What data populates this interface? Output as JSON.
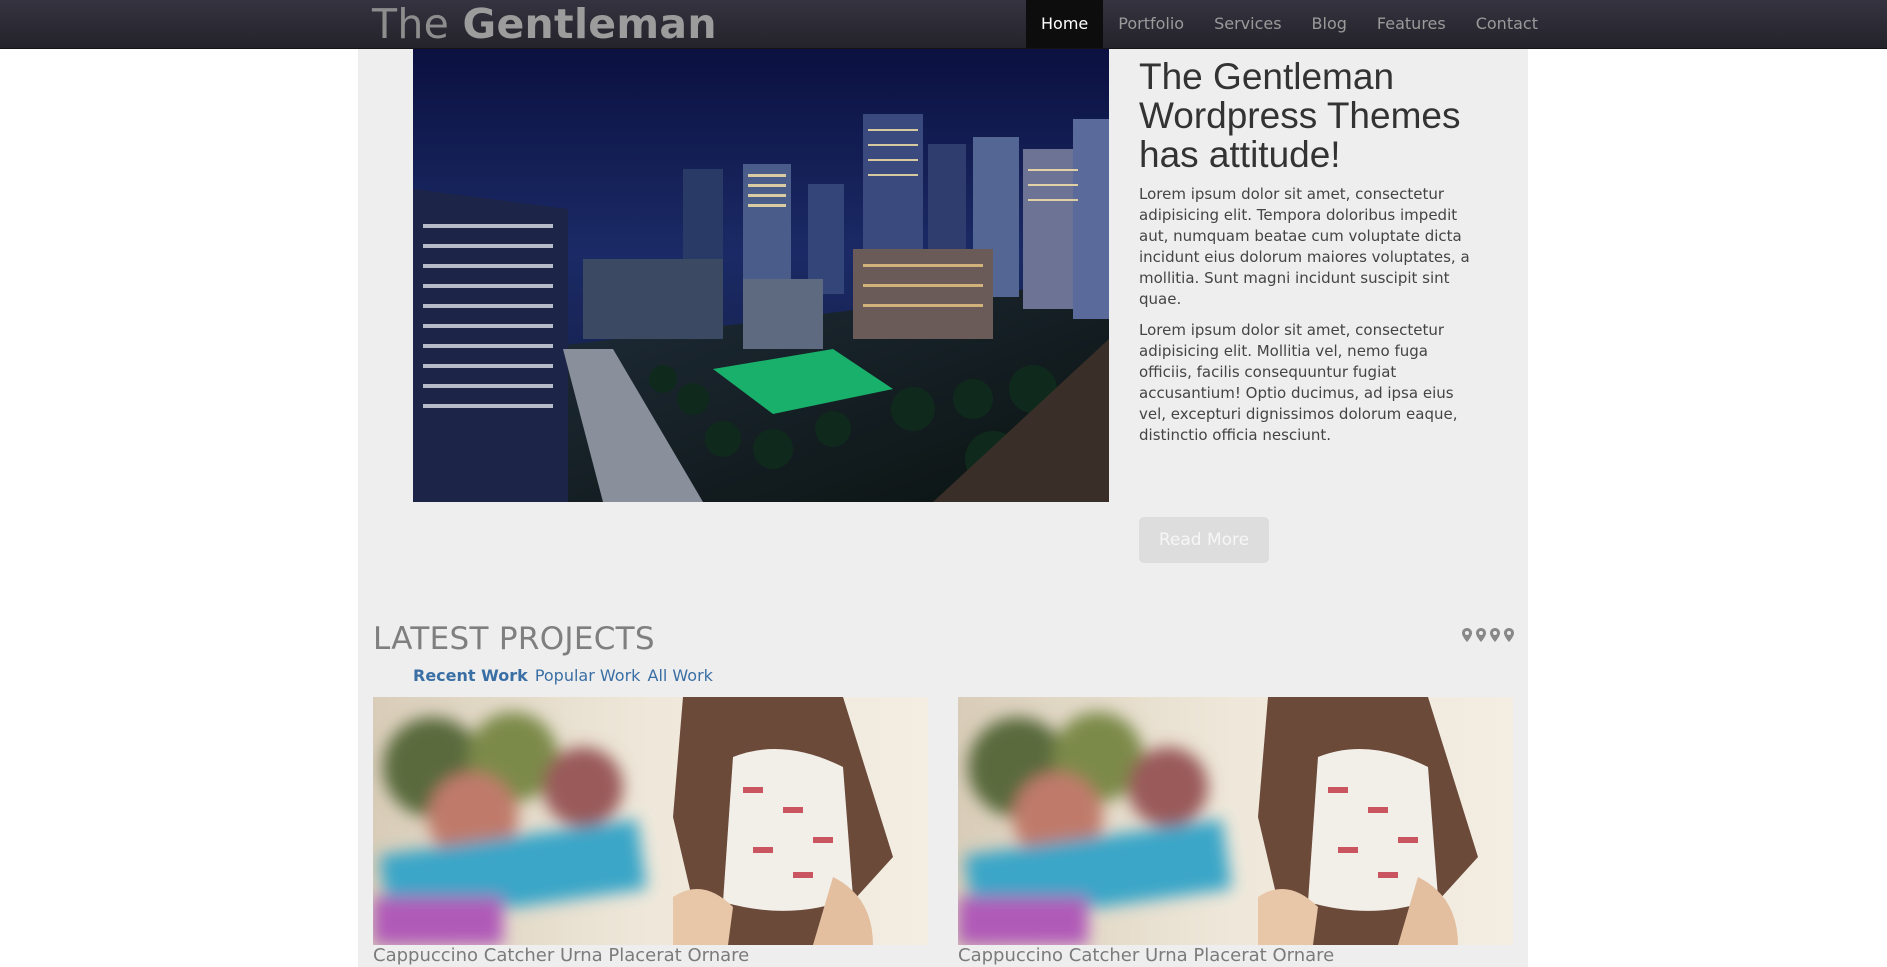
{
  "brand": {
    "prefix": "The",
    "name": "Gentleman"
  },
  "nav": {
    "items": [
      {
        "label": "Home",
        "active": true
      },
      {
        "label": "Portfolio"
      },
      {
        "label": "Services"
      },
      {
        "label": "Blog"
      },
      {
        "label": "Features"
      },
      {
        "label": "Contact"
      }
    ]
  },
  "hero": {
    "title": "The Gentleman Wordpress Themes has attitude!",
    "paragraphs": [
      "Lorem ipsum dolor sit amet, consectetur adipisicing elit. Tempora doloribus impedit aut, numquam beatae cum voluptate dicta incidunt eius dolorum maiores voluptates, a mollitia. Sunt magni incidunt suscipit sint quae.",
      "Lorem ipsum dolor sit amet, consectetur adipisicing elit. Mollitia vel, nemo fuga officiis, facilis consequuntur fugiat accusantium! Optio ducimus, ad ipsa eius vel, excepturi dignissimos dolorum eaque, distinctio officia nesciunt."
    ],
    "button": "Read More"
  },
  "projects": {
    "title": "LATEST PROJECTS",
    "filters": [
      "Recent Work",
      "Popular Work",
      "All Work"
    ],
    "active_filter": "Recent Work",
    "pager_count": 4,
    "cards": [
      {
        "title": "Cappuccino Catcher Urna Placerat Ornare"
      },
      {
        "title": "Cappuccino Catcher Urna Placerat Ornare"
      }
    ]
  },
  "colors": {
    "nav_bg": "#2d2b34",
    "container_bg": "#eeeeee",
    "link": "#3a6fa5",
    "button_bg": "#dddddd"
  }
}
